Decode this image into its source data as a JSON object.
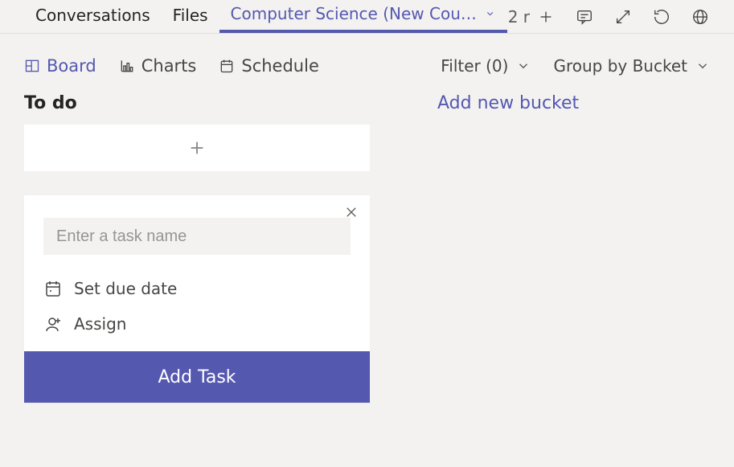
{
  "tabs": {
    "conversations": "Conversations",
    "files": "Files",
    "active": "Computer Science (New Cours…"
  },
  "header": {
    "channel_meta": "2 r"
  },
  "views": {
    "board": "Board",
    "charts": "Charts",
    "schedule": "Schedule"
  },
  "toolbar": {
    "filter": "Filter (0)",
    "group": "Group by Bucket"
  },
  "board": {
    "column_title": "To do",
    "add_bucket": "Add new bucket"
  },
  "card": {
    "task_placeholder": "Enter a task name",
    "due_date": "Set due date",
    "assign": "Assign",
    "add_task": "Add Task"
  }
}
